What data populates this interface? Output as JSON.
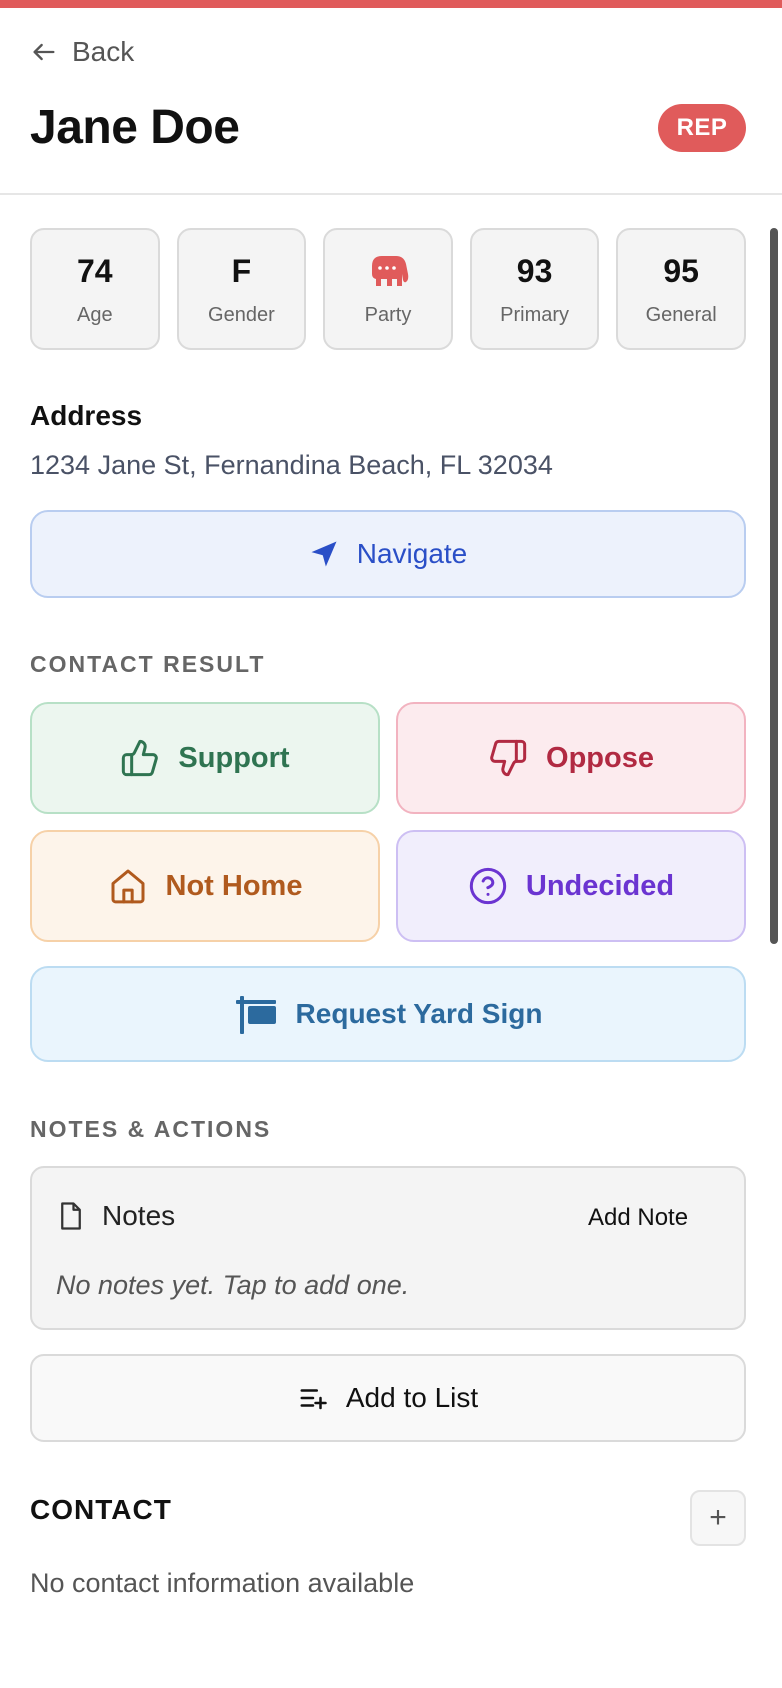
{
  "colors": {
    "accent_red": "#e05b5b",
    "support_green": "#2f7451",
    "oppose_red": "#b12a42",
    "nothome_orange": "#b05a1e",
    "undecided_purple": "#6b34d1",
    "navigate_blue": "#2a4fc7",
    "yardsign_blue": "#2c6a9e"
  },
  "header": {
    "back_label": "Back",
    "voter_name": "Jane Doe",
    "party_badge": "REP"
  },
  "stats": [
    {
      "value": "74",
      "label": "Age"
    },
    {
      "value": "F",
      "label": "Gender"
    },
    {
      "icon": "elephant-icon",
      "label": "Party"
    },
    {
      "value": "93",
      "label": "Primary"
    },
    {
      "value": "95",
      "label": "General"
    }
  ],
  "address": {
    "title": "Address",
    "text": "1234 Jane St, Fernandina Beach, FL 32034",
    "navigate_label": "Navigate"
  },
  "contact_result": {
    "section_label": "CONTACT RESULT",
    "support": "Support",
    "oppose": "Oppose",
    "not_home": "Not Home",
    "undecided": "Undecided",
    "yard_sign": "Request Yard Sign"
  },
  "notes_actions": {
    "section_label": "NOTES & ACTIONS",
    "notes_title": "Notes",
    "add_note": "Add Note",
    "empty_text": "No notes yet. Tap to add one.",
    "add_to_list": "Add to List"
  },
  "contact": {
    "title": "CONTACT",
    "add_symbol": "+",
    "empty_text": "No contact information available"
  }
}
